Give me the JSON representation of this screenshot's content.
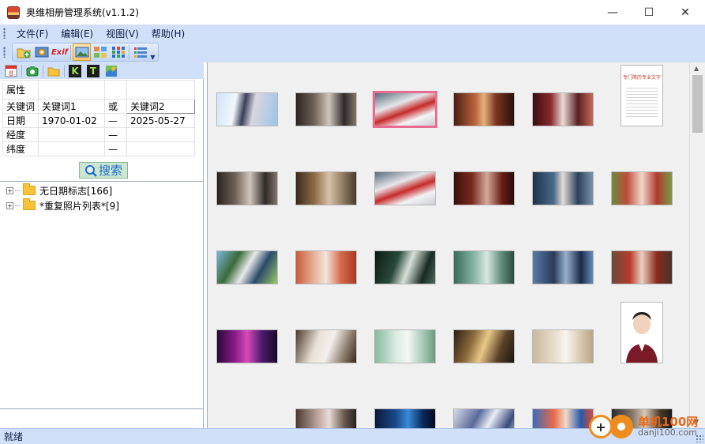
{
  "window": {
    "title": "奥维相册管理系统(v1.1.2)",
    "min_glyph": "—",
    "max_glyph": "☐",
    "close_glyph": "✕"
  },
  "menu": {
    "items": [
      {
        "label": "文件(F)",
        "icon": "none"
      },
      {
        "label": "编辑(E)",
        "icon": "none"
      },
      {
        "label": "视图(V)",
        "icon": "none"
      },
      {
        "label": "帮助(H)",
        "icon": "none"
      }
    ]
  },
  "toolbar": {
    "exif_label": "Exif",
    "icons": [
      "folder-add-icon",
      "image-settings-icon",
      "exif-icon",
      "large-thumbnails-icon",
      "medium-thumbnails-icon",
      "small-thumbnails-icon",
      "details-list-icon",
      "overflow-chevron-icon"
    ]
  },
  "left_toolbar": {
    "calendar_day": "8",
    "k_label": "K",
    "t_label": "T",
    "icons": [
      "calendar-icon",
      "camera-icon",
      "folder-icon",
      "keyword-k-icon",
      "text-t-icon",
      "map-icon"
    ]
  },
  "properties": {
    "header": "属性",
    "rows": [
      {
        "label": "关键词",
        "col1": "关键词1",
        "col2": "或",
        "col3": "关键词2"
      },
      {
        "label": "日期",
        "col1": "1970-01-02",
        "col2": "—",
        "col3": "2025-05-27"
      },
      {
        "label": "经度",
        "col1": "",
        "col2": "—",
        "col3": ""
      },
      {
        "label": "纬度",
        "col1": "",
        "col2": "—",
        "col3": ""
      }
    ]
  },
  "search": {
    "label": "搜索",
    "icon": "magnifier-icon"
  },
  "tree": {
    "items": [
      {
        "label": "无日期标志[166]",
        "expander": "+"
      },
      {
        "label": "*重复照片列表*[9]",
        "expander": "+"
      }
    ]
  },
  "status": {
    "text": "就绪"
  },
  "watermark": {
    "line1": "单机100网",
    "line2": "danji100.com",
    "plus": "+"
  },
  "document_thumb": {
    "heading": "专门简历专业文字"
  },
  "scroll": {
    "up": "▲",
    "down": "▼"
  },
  "colors": {
    "chrome_blue": "#cfe0f8",
    "selected_border": "#e86c92",
    "gallery_bg": "#f0f0f0",
    "watermark_orange": "#f08c1e"
  }
}
